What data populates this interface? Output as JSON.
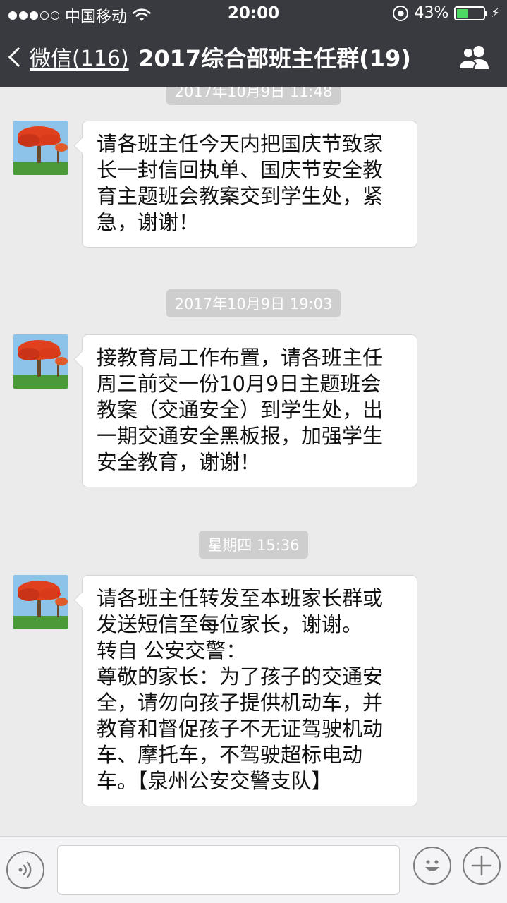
{
  "status_bar": {
    "carrier": "中国移动",
    "time": "20:00",
    "battery_text": "43%",
    "battery_level": 0.43
  },
  "nav": {
    "back_label": "微信(116)",
    "title": "2017综合部班主任群(19)",
    "group_icon": "group-members-icon"
  },
  "chat": {
    "partial_timestamp": "2017年10月9日 11:48",
    "messages": [
      {
        "text": "请各班主任今天内把国庆节致家\n长一封信回执单、国庆节安全教\n育主题班会教案交到学生处，紧\n急，谢谢！"
      },
      {
        "timestamp": "2017年10月9日 19:03",
        "text": "接教育局工作布置，请各班主任\n周三前交一份10月9日主题班会\n教案（交通安全）到学生处，出\n一期交通安全黑板报，加强学生\n安全教育，谢谢！"
      },
      {
        "timestamp": "星期四 15:36",
        "text": "请各班主任转发至本班家长群或\n发送短信至每位家长，谢谢。\n转自 公安交警：\n尊敬的家长：为了孩子的交通安\n全，请勿向孩子提供机动车，并\n教育和督促孩子不无证驾驶机动\n车、摩托车，不驾驶超标电动\n车。【泉州公安交警支队】"
      }
    ]
  },
  "input_bar": {
    "voice_icon": "voice-icon",
    "emoji_icon": "emoji-icon",
    "plus_icon": "plus-icon"
  },
  "colors": {
    "nav_bg": "#393a3f",
    "chat_bg": "#ebebeb",
    "battery_green": "#4cd964"
  }
}
